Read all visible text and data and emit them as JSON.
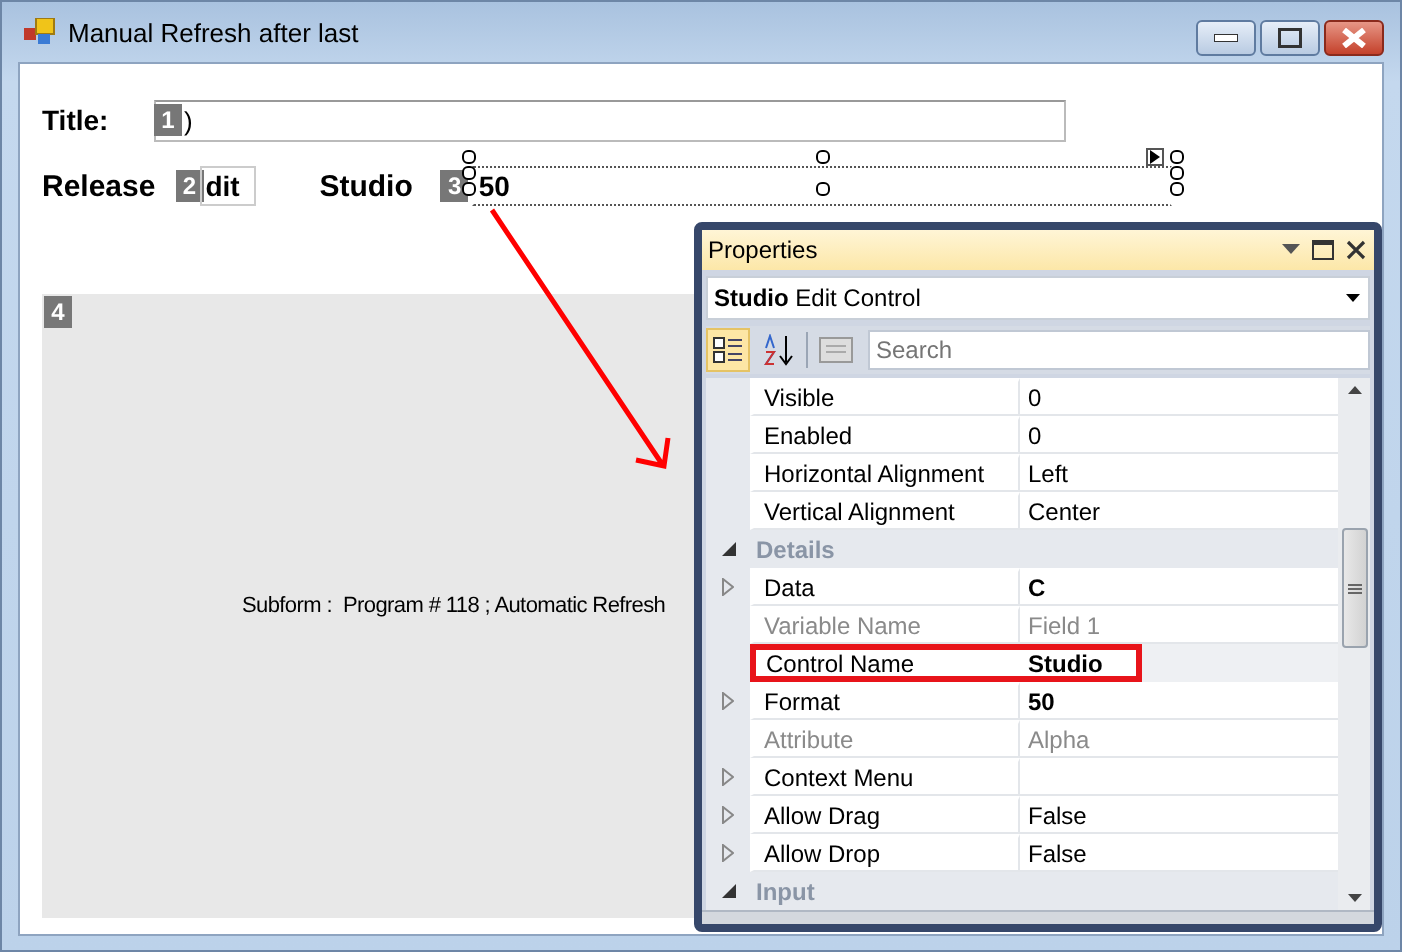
{
  "window": {
    "title": "Manual Refresh after last"
  },
  "form": {
    "title_field": {
      "label": "Title:",
      "badge": "1",
      "value": ")"
    },
    "row_fields": [
      {
        "label": "Release",
        "badge": "2",
        "value": "dit",
        "selected": false
      },
      {
        "label": "Studio",
        "badge": "3",
        "value": "50",
        "selected": true
      }
    ],
    "subform": {
      "badge": "4",
      "text": "Subform :  Program # 118 ; Automatic Refresh"
    }
  },
  "properties": {
    "title": "Properties",
    "object_name": "Studio",
    "object_type": "Edit Control",
    "toolbar": [
      {
        "kind": "categorized",
        "selected": true
      },
      {
        "kind": "alphabetical",
        "selected": false
      },
      {
        "kind": "pages",
        "selected": false
      }
    ],
    "search": {
      "placeholder": "Search"
    },
    "rows": [
      {
        "kind": "property",
        "name": "Visible",
        "value": "0",
        "expandable": false,
        "disabled": false,
        "bold": false,
        "highlighted": false
      },
      {
        "kind": "property",
        "name": "Enabled",
        "value": "0",
        "expandable": false,
        "disabled": false,
        "bold": false,
        "highlighted": false
      },
      {
        "kind": "property",
        "name": "Horizontal Alignment",
        "value": "Left",
        "expandable": false,
        "disabled": false,
        "bold": false,
        "highlighted": false
      },
      {
        "kind": "property",
        "name": "Vertical Alignment",
        "value": "Center",
        "expandable": false,
        "disabled": false,
        "bold": false,
        "highlighted": false
      },
      {
        "kind": "category",
        "name": "Details",
        "expanded": true
      },
      {
        "kind": "property",
        "name": "Data",
        "value": "C",
        "expandable": true,
        "disabled": false,
        "bold": true,
        "highlighted": false
      },
      {
        "kind": "property",
        "name": "Variable Name",
        "value": "Field 1",
        "expandable": false,
        "disabled": true,
        "bold": false,
        "highlighted": false
      },
      {
        "kind": "property",
        "name": "Control Name",
        "value": "Studio",
        "expandable": false,
        "disabled": false,
        "bold": true,
        "highlighted": true
      },
      {
        "kind": "property",
        "name": "Format",
        "value": "50",
        "expandable": true,
        "disabled": false,
        "bold": true,
        "highlighted": false
      },
      {
        "kind": "property",
        "name": "Attribute",
        "value": "Alpha",
        "expandable": false,
        "disabled": true,
        "bold": false,
        "highlighted": false
      },
      {
        "kind": "property",
        "name": "Context Menu",
        "expandable": true,
        "disabled": false,
        "bold": false,
        "highlighted": false
      },
      {
        "kind": "property",
        "name": "Allow Drag",
        "value": "False",
        "expandable": true,
        "disabled": false,
        "bold": false,
        "highlighted": false
      },
      {
        "kind": "property",
        "name": "Allow Drop",
        "value": "False",
        "expandable": true,
        "disabled": false,
        "bold": false,
        "highlighted": false
      },
      {
        "kind": "category",
        "name": "Input",
        "expanded": true
      }
    ]
  }
}
